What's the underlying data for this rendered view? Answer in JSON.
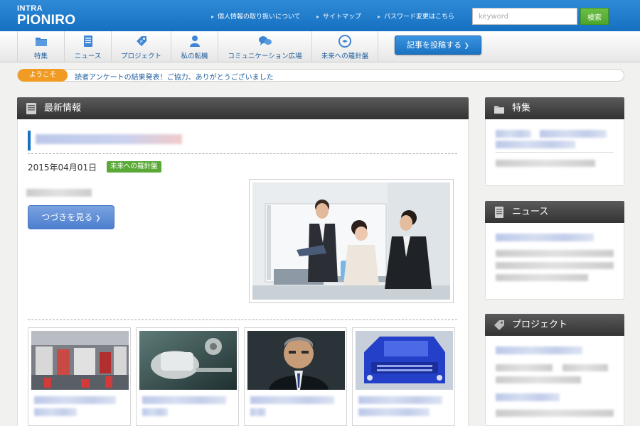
{
  "header": {
    "logo_line1": "INTRA",
    "logo_line2": "PIONIRO",
    "links": [
      "個人情報の取り扱いについて",
      "サイトマップ",
      "パスワード変更はこちら"
    ],
    "search_placeholder": "keyword",
    "search_button": "検索"
  },
  "nav": {
    "items": [
      {
        "label": "特集",
        "icon": "folder-icon"
      },
      {
        "label": "ニュース",
        "icon": "document-icon"
      },
      {
        "label": "プロジェクト",
        "icon": "tag-icon"
      },
      {
        "label": "私の転機",
        "icon": "person-icon"
      },
      {
        "label": "コミュニケーション広場",
        "icon": "chat-bubbles-icon"
      },
      {
        "label": "未来への羅針盤",
        "icon": "compass-icon"
      }
    ],
    "post_button": "記事を投稿する"
  },
  "ticker": {
    "badge": "ようこそ",
    "text": "読者アンケートの結果発表！ご協力、ありがとうございました"
  },
  "main": {
    "title": "最新情報",
    "article": {
      "date": "2015年04月01日",
      "category": "未来への羅針盤",
      "more_button": "つづきを見る"
    }
  },
  "sidebar": {
    "panels": [
      {
        "title": "特集",
        "icon": "folder-icon"
      },
      {
        "title": "ニュース",
        "icon": "document-icon"
      },
      {
        "title": "プロジェクト",
        "icon": "tag-icon"
      }
    ]
  },
  "colors": {
    "header_blue": "#1670c2",
    "accent_green": "#5aa937",
    "badge_orange": "#f29b24",
    "panel_dark": "#3a3a3a"
  }
}
